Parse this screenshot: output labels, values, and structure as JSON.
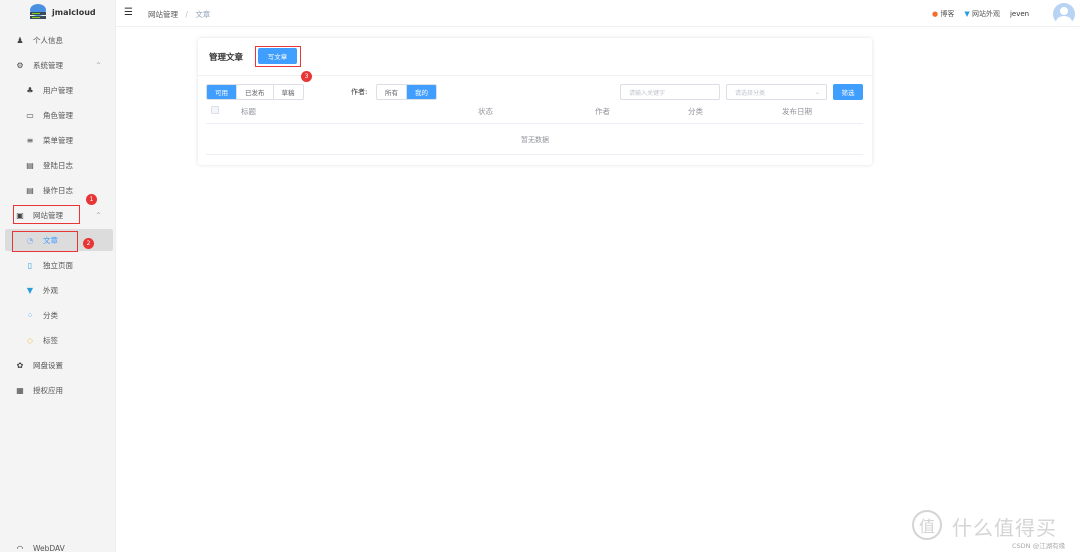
{
  "brand": "jmalcloud",
  "sidebar": {
    "items": [
      {
        "label": "个人信息",
        "icon": "user-icon"
      },
      {
        "label": "系统管理",
        "icon": "gear-icon"
      },
      {
        "label": "用户管理",
        "icon": "users-icon"
      },
      {
        "label": "角色管理",
        "icon": "id-card-icon"
      },
      {
        "label": "菜单管理",
        "icon": "sliders-icon"
      },
      {
        "label": "登陆日志",
        "icon": "log-icon"
      },
      {
        "label": "操作日志",
        "icon": "log-icon"
      },
      {
        "label": "网站管理",
        "icon": "website-icon"
      },
      {
        "label": "文章",
        "icon": "article-icon"
      },
      {
        "label": "独立页面",
        "icon": "page-icon"
      },
      {
        "label": "外观",
        "icon": "shirt-icon"
      },
      {
        "label": "分类",
        "icon": "grid-icon"
      },
      {
        "label": "标签",
        "icon": "tag-icon"
      },
      {
        "label": "网盘设置",
        "icon": "cloud-settings-icon"
      },
      {
        "label": "授权应用",
        "icon": "app-icon"
      },
      {
        "label": "WebDAV",
        "icon": "webdav-icon"
      }
    ]
  },
  "breadcrumb": [
    "网站管理",
    "文章"
  ],
  "breadcrumb_sep": "/",
  "header": {
    "blog": "博客",
    "appearance": "网站外观",
    "user": "jeven"
  },
  "card": {
    "title": "管理文章",
    "write_button": "写文章",
    "status_tabs": [
      "可用",
      "已发布",
      "草稿"
    ],
    "author_label": "作者:",
    "author_tabs": [
      "所有",
      "我的"
    ],
    "keyword_placeholder": "请输入关键字",
    "category_placeholder": "请选择分类",
    "filter_button": "筛选",
    "columns": [
      "标题",
      "状态",
      "作者",
      "分类",
      "发布日期"
    ],
    "empty": "暂无数据"
  },
  "annotations": [
    "1",
    "2",
    "3"
  ],
  "watermark": {
    "logo": "值",
    "text": "什么值得买",
    "credit": "CSDN @江湖有缘"
  },
  "colors": {
    "primary": "#409eff",
    "annotation": "#e83535"
  }
}
